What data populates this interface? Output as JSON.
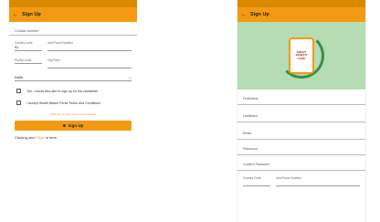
{
  "left": {
    "status": {
      "time": "",
      "icons": ""
    },
    "appbar": {
      "back": "←",
      "title": "Sign Up"
    },
    "fields": {
      "contact_number": "Contact Number",
      "country_code_label": "Country Code",
      "country_code_value": "91",
      "phone_label": "Add Phone Number",
      "phone_hint": "",
      "pincode_label": "Pin/Zip Code",
      "pincode_value": "",
      "city_label": "City/Town",
      "city_hint": "",
      "state_label": "",
      "state_value": "Delhi"
    },
    "checkbox": {
      "first": "Yes, I would also like to sign up for the newsletter",
      "second": "I accept Health Based Perks Terms and Conditions"
    },
    "link": "Click here to view Terms and Conditions",
    "signup_button": "Sign Up",
    "footer": {
      "prefix": "Clicking yes? ",
      "accent": "Sign",
      "suffix": " in here"
    }
  },
  "right": {
    "status": {
      "time": "",
      "icons": ""
    },
    "appbar": {
      "back": "←",
      "title": "Sign Up"
    },
    "hero": {
      "badge": "SMART\nBENEFIT\nCARD"
    },
    "fields": {
      "firstname": "FirstName",
      "lastname": "LastName",
      "email": "Email",
      "email_hint": "",
      "password": "Password",
      "password_hint": "",
      "confirm_password": "Confirm Password",
      "confirm_hint": "",
      "country_code": "Country Code",
      "phone": "Add Phone Number"
    }
  }
}
